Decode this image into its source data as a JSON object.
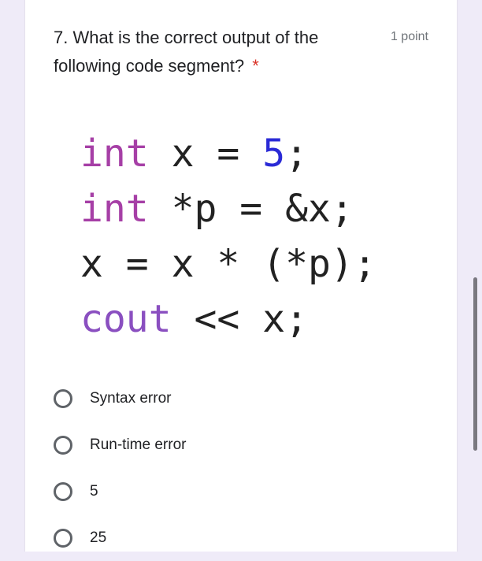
{
  "question": {
    "number": "7.",
    "text": "What is the correct output of the following code segment?",
    "required_marker": "*",
    "points": "1 point"
  },
  "code": {
    "lines": [
      [
        {
          "t": "int",
          "c": "kw"
        },
        {
          "t": " x = ",
          "c": ""
        },
        {
          "t": "5",
          "c": "num"
        },
        {
          "t": ";",
          "c": ""
        }
      ],
      [
        {
          "t": "int",
          "c": "kw"
        },
        {
          "t": " *p = &x;",
          "c": ""
        }
      ],
      [
        {
          "t": "x = x * (*p);",
          "c": ""
        }
      ],
      [
        {
          "t": "cout",
          "c": "kw2"
        },
        {
          "t": " << x;",
          "c": ""
        }
      ]
    ]
  },
  "options": [
    {
      "label": "Syntax error",
      "selected": false
    },
    {
      "label": "Run-time error",
      "selected": false
    },
    {
      "label": "5",
      "selected": false
    },
    {
      "label": "25",
      "selected": false
    }
  ],
  "colors": {
    "background": "#efebf8",
    "keyword": "#a63fa6",
    "number": "#2a2ad6",
    "required": "#d93025"
  }
}
